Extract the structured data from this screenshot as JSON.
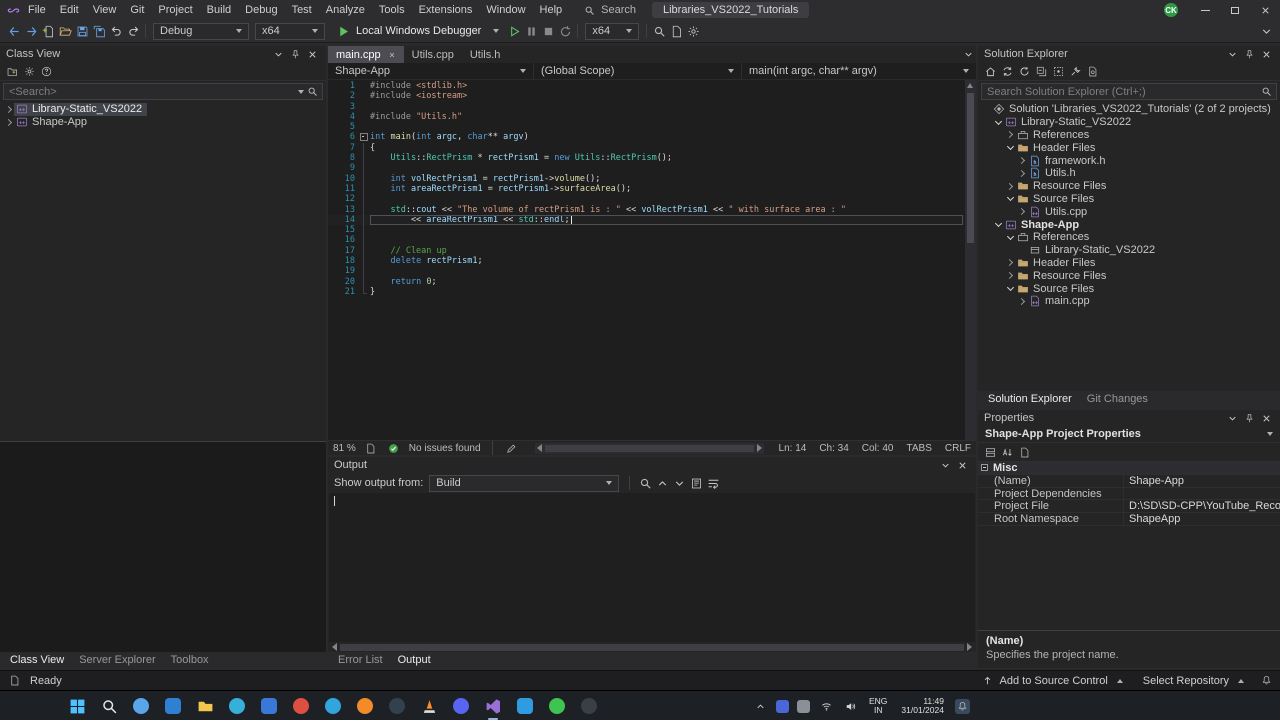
{
  "colors": {
    "accent_blue": "#007acc",
    "debug_green": "#62c062",
    "health_green": "#44a04a",
    "vs_purple": "#9a70d8"
  },
  "titlebar": {
    "menus": [
      "File",
      "Edit",
      "View",
      "Git",
      "Project",
      "Build",
      "Debug",
      "Test",
      "Analyze",
      "Tools",
      "Extensions",
      "Window",
      "Help"
    ],
    "search_label": "Search",
    "solution_name": "Libraries_VS2022_Tutorials",
    "avatar_initials": "CK"
  },
  "ui": {
    "panel_header_icons": [
      "chevron-down",
      "pin",
      "close"
    ],
    "output_header_icons": [
      "chevron-down",
      "close"
    ]
  },
  "toolbar": {
    "left_icons": [
      "back",
      "forward",
      "new-file",
      "open-file",
      "save",
      "save-all",
      "undo",
      "redo"
    ],
    "config": "Debug",
    "platform": "x64",
    "run_label": "Local Windows Debugger",
    "debug_icons": [
      "start-no-debug",
      "break-all",
      "stop",
      "restart"
    ],
    "platform2": "x64",
    "right_icons": [
      "find",
      "doc",
      "gear"
    ]
  },
  "class_view": {
    "title": "Class View",
    "toolbar_icons": [
      "add-folder",
      "gear",
      "help"
    ],
    "search_placeholder": "<Search>",
    "items": [
      {
        "label": "Library-Static_VS2022",
        "selected": true
      },
      {
        "label": "Shape-App",
        "selected": false
      }
    ],
    "tabs": [
      {
        "label": "Class View",
        "active": true
      },
      {
        "label": "Server Explorer",
        "active": false
      },
      {
        "label": "Toolbox",
        "active": false
      }
    ]
  },
  "editor": {
    "tabs": [
      {
        "label": "main.cpp",
        "active": true
      },
      {
        "label": "Utils.cpp",
        "active": false
      },
      {
        "label": "Utils.h",
        "active": false
      }
    ],
    "navbar": {
      "project": "Shape-App",
      "scope": "(Global Scope)",
      "member": "main(int argc, char** argv)"
    },
    "active_line": 14,
    "code": [
      {
        "fold": "",
        "tokens": [
          [
            "p",
            "#include "
          ],
          [
            "s",
            "<stdlib.h>"
          ]
        ]
      },
      {
        "fold": "",
        "tokens": [
          [
            "p",
            "#include "
          ],
          [
            "s",
            "<iostream>"
          ]
        ]
      },
      {
        "fold": "",
        "tokens": []
      },
      {
        "fold": "",
        "tokens": [
          [
            "p",
            "#include "
          ],
          [
            "s",
            "\"Utils.h\""
          ]
        ]
      },
      {
        "fold": "",
        "tokens": []
      },
      {
        "fold": "s",
        "tokens": [
          [
            "k",
            "int "
          ],
          [
            "fn",
            "main"
          ],
          [
            "d",
            "("
          ],
          [
            "k",
            "int "
          ],
          [
            "v",
            "argc"
          ],
          [
            "d",
            ", "
          ],
          [
            "k",
            "char"
          ],
          [
            "d",
            "** "
          ],
          [
            "v",
            "argv"
          ],
          [
            "d",
            ")"
          ]
        ]
      },
      {
        "fold": "l",
        "tokens": [
          [
            "d",
            "{"
          ]
        ]
      },
      {
        "fold": "l",
        "tokens": [
          [
            "d",
            "    "
          ],
          [
            "t",
            "Utils"
          ],
          [
            "d",
            "::"
          ],
          [
            "t",
            "RectPrism"
          ],
          [
            "d",
            " * "
          ],
          [
            "v",
            "rectPrism1"
          ],
          [
            "d",
            " = "
          ],
          [
            "k",
            "new "
          ],
          [
            "t",
            "Utils"
          ],
          [
            "d",
            "::"
          ],
          [
            "t",
            "RectPrism"
          ],
          [
            "d",
            "();"
          ]
        ]
      },
      {
        "fold": "l",
        "tokens": []
      },
      {
        "fold": "l",
        "tokens": [
          [
            "d",
            "    "
          ],
          [
            "k",
            "int "
          ],
          [
            "v",
            "volRectPrism1"
          ],
          [
            "d",
            " = "
          ],
          [
            "v",
            "rectPrism1"
          ],
          [
            "d",
            "->"
          ],
          [
            "fn",
            "volume"
          ],
          [
            "d",
            "();"
          ]
        ]
      },
      {
        "fold": "l",
        "tokens": [
          [
            "d",
            "    "
          ],
          [
            "k",
            "int "
          ],
          [
            "v",
            "areaRectPrism1"
          ],
          [
            "d",
            " = "
          ],
          [
            "v",
            "rectPrism1"
          ],
          [
            "d",
            "->"
          ],
          [
            "fn",
            "surfaceArea"
          ],
          [
            "d",
            "();"
          ]
        ]
      },
      {
        "fold": "l",
        "tokens": []
      },
      {
        "fold": "l",
        "tokens": [
          [
            "d",
            "    "
          ],
          [
            "t",
            "std"
          ],
          [
            "d",
            "::"
          ],
          [
            "v",
            "cout"
          ],
          [
            "d",
            " << "
          ],
          [
            "s",
            "\"The volume of rectPrism1 is : \""
          ],
          [
            "d",
            " << "
          ],
          [
            "v",
            "volRectPrism1"
          ],
          [
            "d",
            " << "
          ],
          [
            "s",
            "\" with surface area : \""
          ]
        ]
      },
      {
        "fold": "l",
        "tokens": [
          [
            "d",
            "        << "
          ],
          [
            "v",
            "areaRectPrism1"
          ],
          [
            "d",
            " << "
          ],
          [
            "t",
            "std"
          ],
          [
            "d",
            "::"
          ],
          [
            "v",
            "endl"
          ],
          [
            "d",
            ";"
          ]
        ]
      },
      {
        "fold": "l",
        "tokens": []
      },
      {
        "fold": "l",
        "tokens": []
      },
      {
        "fold": "l",
        "tokens": [
          [
            "c",
            "    // Clean up"
          ]
        ]
      },
      {
        "fold": "l",
        "tokens": [
          [
            "d",
            "    "
          ],
          [
            "k",
            "delete "
          ],
          [
            "v",
            "rectPrism1"
          ],
          [
            "d",
            ";"
          ]
        ]
      },
      {
        "fold": "l",
        "tokens": []
      },
      {
        "fold": "l",
        "tokens": [
          [
            "d",
            "    "
          ],
          [
            "k",
            "return "
          ],
          [
            "n",
            "0"
          ],
          [
            "d",
            ";"
          ]
        ]
      },
      {
        "fold": "e",
        "tokens": [
          [
            "d",
            "}"
          ]
        ]
      }
    ],
    "status": {
      "zoom": "81 %",
      "issues": "No issues found",
      "ln": "Ln: 14",
      "ch": "Ch: 34",
      "col": "Col: 40",
      "tabs_label": "TABS",
      "eol": "CRLF"
    }
  },
  "output": {
    "title": "Output",
    "from_label": "Show output from:",
    "source": "Build",
    "toolbar_icons": [
      "find-message",
      "prev-message",
      "next-message",
      "clear-all",
      "word-wrap"
    ],
    "tabs": [
      {
        "label": "Error List",
        "active": false
      },
      {
        "label": "Output",
        "active": true
      }
    ]
  },
  "solution_explorer": {
    "title": "Solution Explorer",
    "toolbar_icons": [
      "home",
      "sync",
      "refresh",
      "collapse-all",
      "show-all-files",
      "properties",
      "preview"
    ],
    "search_placeholder": "Search Solution Explorer (Ctrl+;)",
    "tree": [
      {
        "label": "Solution 'Libraries_VS2022_Tutorials' (2 of 2 projects)",
        "level": 0,
        "icon": "solution",
        "arrow": ""
      },
      {
        "label": "Library-Static_VS2022",
        "level": 1,
        "icon": "cpp-project",
        "arrow": "e"
      },
      {
        "label": "References",
        "level": 2,
        "icon": "references",
        "arrow": "c"
      },
      {
        "label": "Header Files",
        "level": 2,
        "icon": "folder",
        "arrow": "e"
      },
      {
        "label": "framework.h",
        "level": 3,
        "icon": "h-file",
        "arrow": "c"
      },
      {
        "label": "Utils.h",
        "level": 3,
        "icon": "h-file",
        "arrow": "c"
      },
      {
        "label": "Resource Files",
        "level": 2,
        "icon": "folder",
        "arrow": "c"
      },
      {
        "label": "Source Files",
        "level": 2,
        "icon": "folder",
        "arrow": "e"
      },
      {
        "label": "Utils.cpp",
        "level": 3,
        "icon": "cpp-file",
        "arrow": "c"
      },
      {
        "label": "Shape-App",
        "level": 1,
        "icon": "cpp-project",
        "arrow": "e",
        "bold": true
      },
      {
        "label": "References",
        "level": 2,
        "icon": "references",
        "arrow": "e"
      },
      {
        "label": "Library-Static_VS2022",
        "level": 3,
        "icon": "reference",
        "arrow": ""
      },
      {
        "label": "Header Files",
        "level": 2,
        "icon": "folder",
        "arrow": "c"
      },
      {
        "label": "Resource Files",
        "level": 2,
        "icon": "folder",
        "arrow": "c"
      },
      {
        "label": "Source Files",
        "level": 2,
        "icon": "folder",
        "arrow": "e"
      },
      {
        "label": "main.cpp",
        "level": 3,
        "icon": "cpp-file",
        "arrow": "c"
      }
    ],
    "tabs": [
      {
        "label": "Solution Explorer",
        "active": true
      },
      {
        "label": "Git Changes",
        "active": false
      }
    ]
  },
  "properties": {
    "title": "Properties",
    "object_name": "Shape-App Project Properties",
    "toolbar_icons": [
      "categorized",
      "alphabetical",
      "property-pages"
    ],
    "section": "Misc",
    "rows": [
      {
        "name": "(Name)",
        "value": "Shape-App"
      },
      {
        "name": "Project Dependencies",
        "value": ""
      },
      {
        "name": "Project File",
        "value": "D:\\SD\\SD-CPP\\YouTube_Recordings\\Libra"
      },
      {
        "name": "Root Namespace",
        "value": "ShapeApp"
      }
    ],
    "description_title": "(Name)",
    "description_text": "Specifies the project name."
  },
  "status_bar": {
    "ready": "Ready",
    "add_source_control": "Add to Source Control",
    "select_repository": "Select Repository"
  },
  "taskbar": {
    "apps": [
      {
        "name": "widgets",
        "color": "#58a6e8",
        "shape": "circle"
      },
      {
        "name": "outlook",
        "color": "#2f7fd3",
        "shape": "square"
      },
      {
        "name": "file-explorer",
        "color": "#f3c74f",
        "shape": "folder"
      },
      {
        "name": "edge",
        "color": "#36b0d8",
        "shape": "circle"
      },
      {
        "name": "store",
        "color": "#3a78d8",
        "shape": "square"
      },
      {
        "name": "chrome",
        "color": "#dd4f43",
        "shape": "circle"
      },
      {
        "name": "telegram",
        "color": "#32a5dc",
        "shape": "circle"
      },
      {
        "name": "firefox",
        "color": "#f28b28",
        "shape": "circle"
      },
      {
        "name": "steam",
        "color": "#32414e",
        "shape": "circle"
      },
      {
        "name": "vlc",
        "color": "#ff8e26",
        "shape": "cone"
      },
      {
        "name": "discord",
        "color": "#5865f2",
        "shape": "circle"
      },
      {
        "name": "visual-studio",
        "color": "#9a70d8",
        "shape": "vs",
        "active": true
      },
      {
        "name": "vs-code",
        "color": "#2f9be0",
        "shape": "square"
      },
      {
        "name": "whatsapp",
        "color": "#3fc351",
        "shape": "circle"
      },
      {
        "name": "obs-studio",
        "color": "#3a3f46",
        "shape": "circle"
      }
    ],
    "tray": {
      "lang_top": "ENG",
      "lang_bottom": "IN",
      "time": "11:49",
      "date": "31/01/2024"
    }
  }
}
